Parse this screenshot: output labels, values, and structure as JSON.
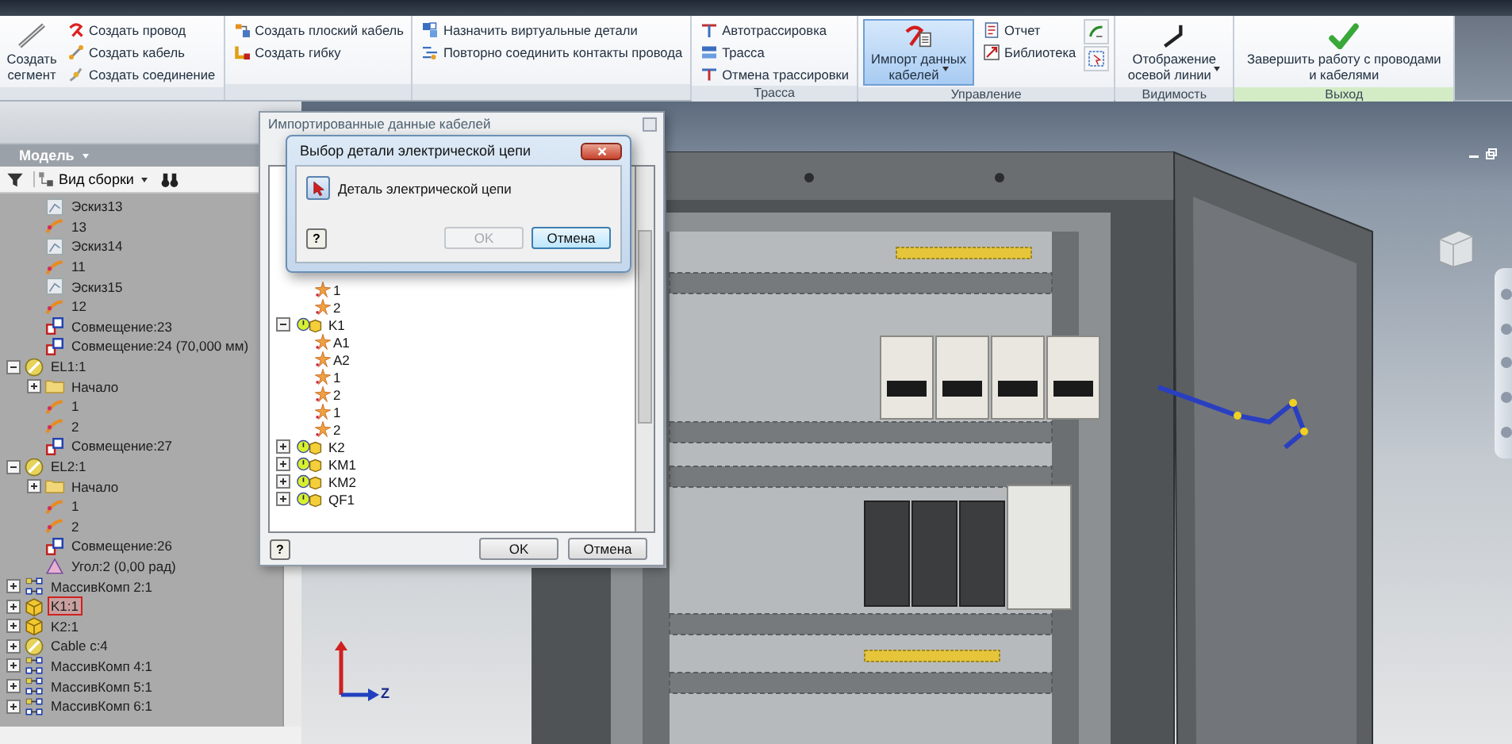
{
  "ribbon": {
    "panels": [
      {
        "color": "#dfe4ea",
        "columns": [
          [
            {
              "kind": "large",
              "label": "Создать сегмент",
              "active": false,
              "dropdown": false
            }
          ],
          [
            {
              "kind": "small",
              "label": "Создать провод"
            },
            {
              "kind": "small",
              "label": "Создать кабель"
            },
            {
              "kind": "small",
              "label": "Создать соединение"
            }
          ]
        ]
      },
      {
        "color": "#dfe4ea",
        "columns": [
          [
            {
              "kind": "small",
              "label": "Создать плоский кабель"
            },
            {
              "kind": "small",
              "label": "Создать гибку"
            }
          ]
        ]
      },
      {
        "color": "#dfe4ea",
        "columns": [
          [
            {
              "kind": "small",
              "label": "Назначить виртуальные детали"
            },
            {
              "kind": "small",
              "label": "Повторно соединить контакты провода"
            }
          ]
        ]
      },
      {
        "title": "Трасса",
        "color": "#dfe4ea",
        "columns": [
          [
            {
              "kind": "small",
              "label": "Автотрассировка"
            },
            {
              "kind": "small",
              "label": "Трасса"
            },
            {
              "kind": "small",
              "label": "Отмена трассировки"
            }
          ]
        ]
      },
      {
        "title": "Управление",
        "color": "#dfe4ea",
        "columns": [
          [
            {
              "kind": "large",
              "label": "Импорт данных кабелей",
              "active": true,
              "dropdown": true
            }
          ],
          [
            {
              "kind": "small",
              "label": "Отчет"
            },
            {
              "kind": "small",
              "label": "Библиотека"
            }
          ],
          [
            {
              "kind": "icon"
            },
            {
              "kind": "icon"
            }
          ]
        ]
      },
      {
        "title": "Видимость",
        "color": "#dfe4ea",
        "columns": [
          [
            {
              "kind": "large",
              "label": "Отображение осевой линии",
              "active": false,
              "dropdown": true
            }
          ]
        ]
      },
      {
        "title": "Выход",
        "color": "#d3ecc6",
        "columns": [
          [
            {
              "kind": "large",
              "label": "Завершить работу с проводами и кабелями",
              "active": false,
              "dropdown": false
            }
          ]
        ]
      }
    ]
  },
  "browser": {
    "title": "Модель",
    "view_mode": "Вид сборки",
    "tree": [
      {
        "children": [
          {
            "label": "Эскиз13",
            "kind": "sketch",
            "selected": false
          },
          {
            "label": "13",
            "kind": "wire",
            "selected": false
          },
          {
            "label": "Эскиз14",
            "kind": "sketch",
            "selected": false
          },
          {
            "label": "11",
            "kind": "wire",
            "selected": false
          },
          {
            "label": "Эскиз15",
            "kind": "sketch",
            "selected": false
          },
          {
            "label": "12",
            "kind": "wire",
            "selected": false
          },
          {
            "label": "Совмещение:23",
            "kind": "constraint",
            "selected": false
          },
          {
            "label": "Совмещение:24 (70,000 мм)",
            "kind": "constraint",
            "selected": false
          }
        ]
      },
      {
        "label": "EL1:1",
        "kind": "harness",
        "selected": false,
        "expanded": true,
        "children": [
          {
            "label": "Начало",
            "kind": "folder",
            "selected": false,
            "expanded": false
          },
          {
            "label": "1",
            "kind": "wire",
            "selected": false
          },
          {
            "label": "2",
            "kind": "wire",
            "selected": false
          },
          {
            "label": "Совмещение:27",
            "kind": "constraint",
            "selected": false
          }
        ]
      },
      {
        "label": "EL2:1",
        "kind": "harness",
        "selected": false,
        "expanded": true,
        "children": [
          {
            "label": "Начало",
            "kind": "folder",
            "selected": false,
            "expanded": false
          },
          {
            "label": "1",
            "kind": "wire",
            "selected": false
          },
          {
            "label": "2",
            "kind": "wire",
            "selected": false
          },
          {
            "label": "Совмещение:26",
            "kind": "constraint",
            "selected": false
          },
          {
            "label": "Угол:2 (0,00 рад)",
            "kind": "angle",
            "selected": false
          }
        ]
      },
      {
        "label": "МассивКомп 2:1",
        "kind": "pattern",
        "selected": false,
        "expanded": false
      },
      {
        "label": "K1:1",
        "kind": "part",
        "selected": true,
        "expanded": false
      },
      {
        "label": "K2:1",
        "kind": "part",
        "selected": false,
        "expanded": false
      },
      {
        "label": "Cable c:4",
        "kind": "harness",
        "selected": false,
        "expanded": false
      },
      {
        "label": "МассивКомп 4:1",
        "kind": "pattern",
        "selected": false,
        "expanded": false
      },
      {
        "label": "МассивКомп 5:1",
        "kind": "pattern",
        "selected": false,
        "expanded": false
      },
      {
        "label": "МассивКомп 6:1",
        "kind": "pattern",
        "selected": false,
        "expanded": false
      }
    ]
  },
  "import_dialog": {
    "title": "Импортированные данные кабелей",
    "help": "?",
    "tree": [
      {
        "children": [
          {
            "label": "1",
            "kind": "pin"
          },
          {
            "label": "2",
            "kind": "pin"
          }
        ]
      },
      {
        "label": "K1",
        "kind": "component",
        "expanded": true,
        "children": [
          {
            "label": "A1",
            "kind": "pin"
          },
          {
            "label": "A2",
            "kind": "pin"
          },
          {
            "label": "1",
            "kind": "pin"
          },
          {
            "label": "2",
            "kind": "pin"
          },
          {
            "label": "1",
            "kind": "pin"
          },
          {
            "label": "2",
            "kind": "pin"
          }
        ]
      },
      {
        "label": "K2",
        "kind": "component",
        "expanded": false
      },
      {
        "label": "KM1",
        "kind": "component",
        "expanded": false
      },
      {
        "label": "KM2",
        "kind": "component",
        "expanded": false
      },
      {
        "label": "QF1",
        "kind": "component",
        "expanded": false
      }
    ],
    "buttons": [
      {
        "label": "OK",
        "disabled": false,
        "focused": false
      },
      {
        "label": "Отмена",
        "disabled": false,
        "focused": false
      }
    ]
  },
  "select_dialog": {
    "title": "Выбор детали электрической цепи",
    "selector": "Деталь электрической цепи",
    "help": "?",
    "buttons": [
      {
        "label": "OK",
        "disabled": true,
        "focused": false
      },
      {
        "label": "Отмена",
        "disabled": false,
        "focused": true
      }
    ]
  },
  "viewport": {
    "axis_label": "Z"
  }
}
